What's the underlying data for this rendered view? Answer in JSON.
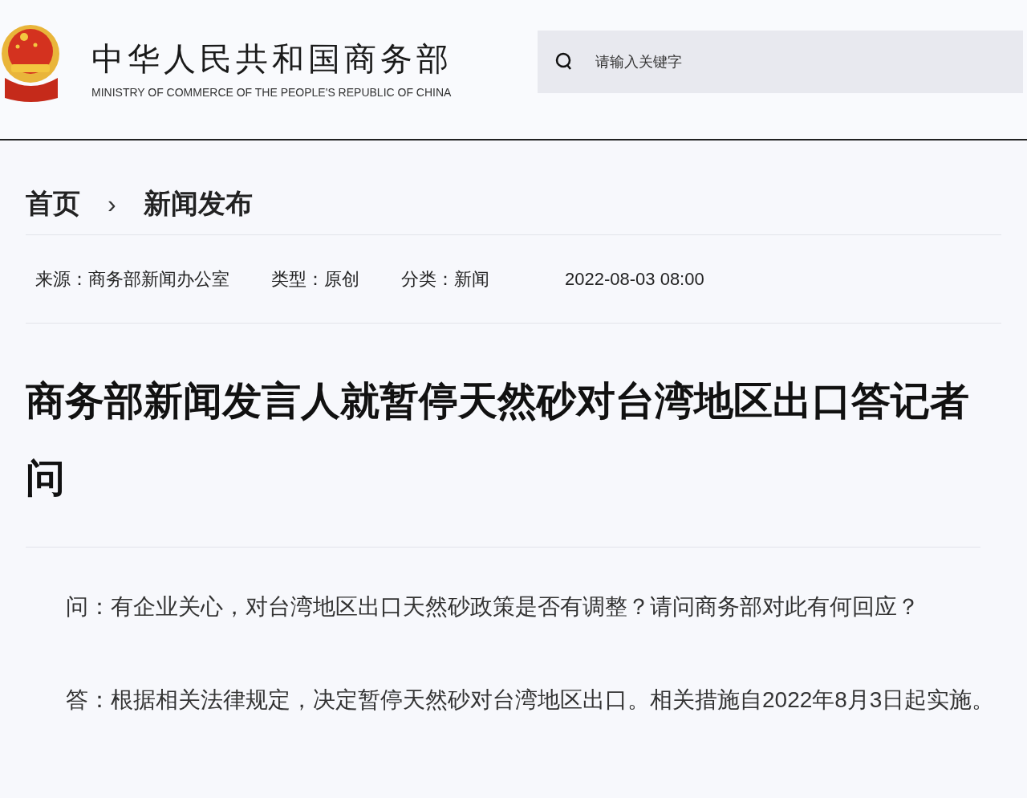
{
  "header": {
    "title": "中华人民共和国商务部",
    "subtitle": "MINISTRY OF COMMERCE OF THE PEOPLE'S REPUBLIC OF CHINA",
    "search": {
      "placeholder": "请输入关键字"
    }
  },
  "breadcrumb": [
    {
      "label": "首页"
    },
    {
      "label": "›"
    },
    {
      "label": "新闻发布"
    }
  ],
  "meta": [
    {
      "label": "来源：",
      "value": "商务部新闻办公室"
    },
    {
      "label": "类型：",
      "value": "原创"
    },
    {
      "label": "分类：",
      "value": "新闻"
    }
  ],
  "date": "2022-08-03 08:00",
  "article": {
    "title": "商务部新闻发言人就暂停天然砂对台湾地区出口答记者问",
    "paragraphs": [
      "问：有企业关心，对台湾地区出口天然砂政策是否有调整？请问商务部对此有何回应？",
      "答：根据相关法律规定，决定暂停天然砂对台湾地区出口。相关措施自2022年8月3日起实施。"
    ]
  }
}
